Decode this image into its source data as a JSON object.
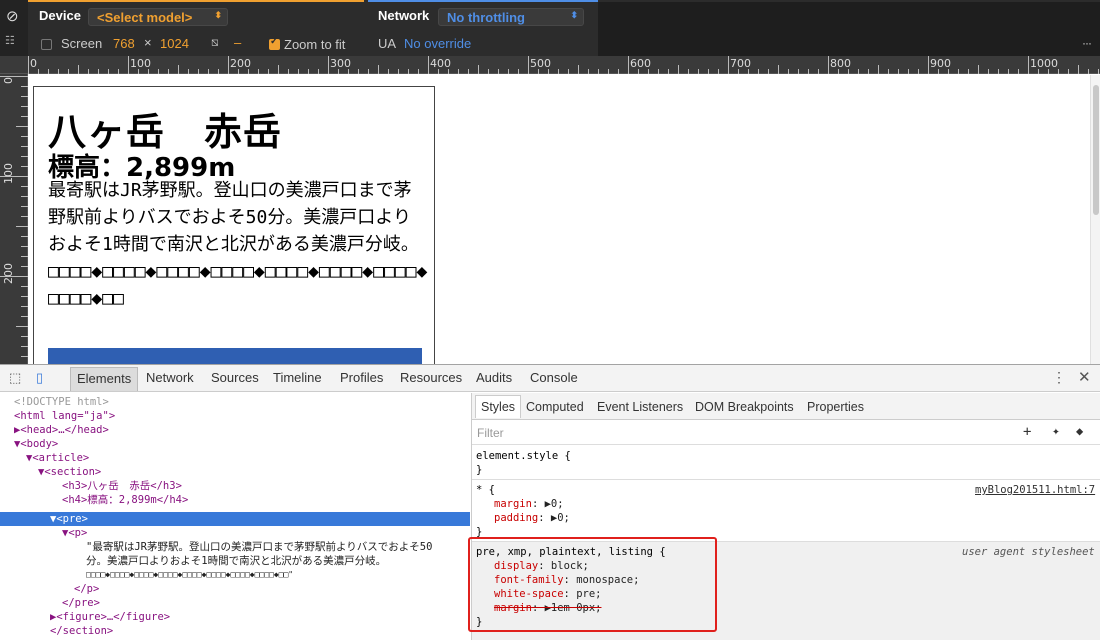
{
  "device_toolbar": {
    "device_label": "Device",
    "model_select": "<Select model>",
    "screen_label": "Screen",
    "width": "768",
    "times": "×",
    "height": "1024",
    "dpr": "–",
    "zoom_to_fit": "Zoom to fit",
    "network_label": "Network",
    "throttling": "No throttling",
    "ua_label": "UA",
    "ua_value": "No override",
    "more": "⋮"
  },
  "rulers": {
    "horizontal": [
      "0",
      "100",
      "200",
      "300",
      "400",
      "500",
      "600",
      "700",
      "800",
      "900",
      "1000"
    ],
    "vertical": [
      "0",
      "100",
      "200"
    ]
  },
  "page": {
    "title": "八ヶ岳　赤岳",
    "elevation": "標高：2,899m",
    "body": "最寄駅はJR茅野駅。登山口の美濃戸口まで茅野駅前よりバスでおよそ50分。美濃戸口よりおよそ1時間で南沢と北沢がある美濃戸分岐。□□□□◆□□□□◆□□□□◆□□□□◆□□□□◆□□□□◆□□□□◆□□□□◆□□"
  },
  "devtools": {
    "tabs": [
      "Elements",
      "Network",
      "Sources",
      "Timeline",
      "Profiles",
      "Resources",
      "Audits",
      "Console"
    ],
    "elements": [
      "<!DOCTYPE html>",
      "<html lang=\"ja\">",
      "▶<head>…</head>",
      "▼<body>",
      "▼<article>",
      "▼<section>",
      "<h3>八ヶ岳　赤岳</h3>",
      "<h4>標高：2,899m</h4>",
      "▼<pre>",
      "▼<p>",
      "\"最寄駅はJR茅野駅。登山口の美濃戸口まで茅野駅前よりバスでおよそ50",
      "分。美濃戸口よりおよそ1時間で南沢と北沢がある美濃戸分岐。",
      "□□□□◆□□□□◆□□□□◆□□□□◆□□□□◆□□□□◆□□□□◆□□□□◆□□\"",
      "</p>",
      "</pre>",
      "▶<figure>…</figure>",
      "</section>"
    ],
    "style_tabs": [
      "Styles",
      "Computed",
      "Event Listeners",
      "DOM Breakpoints",
      "Properties"
    ],
    "filter_placeholder": "Filter",
    "rules": {
      "element_style": "element.style {",
      "close": "}",
      "universal_selector": "* {",
      "universal_source": "myBlog201511.html:7",
      "margin_prop": "margin",
      "margin_val": "0;",
      "padding_prop": "padding",
      "padding_val": "0;",
      "ua_selector": "pre, xmp, plaintext, listing {",
      "ua_source": "user agent stylesheet",
      "display_prop": "display",
      "display_val": "block;",
      "font_prop": "font-family",
      "font_val": "monospace;",
      "ws_prop": "white-space",
      "ws_val": "pre;",
      "margin2_prop": "margin",
      "margin2_val": "1em 0px;"
    }
  },
  "colors": {
    "highlight_box": "#e0201c",
    "selected_row": "#3879d9",
    "device_accent": "#f0a030",
    "network_accent": "#4f8ee6"
  }
}
